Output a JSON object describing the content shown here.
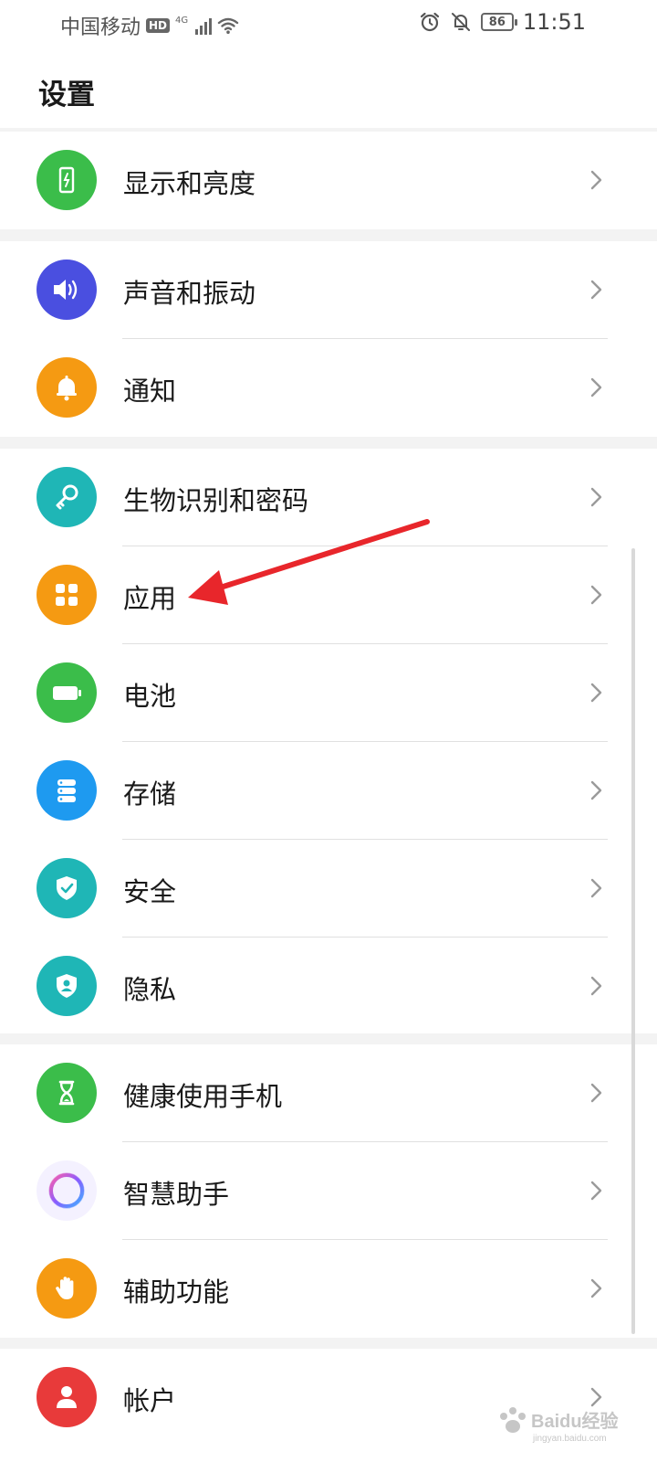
{
  "status_bar": {
    "carrier": "中国移动",
    "hd_badge": "HD",
    "network": "4G",
    "battery": "86",
    "time": "11:51"
  },
  "page": {
    "title": "设置"
  },
  "groups": [
    {
      "items": [
        {
          "label": "显示和亮度",
          "icon": "phone-display-icon",
          "color": "#3bbd4a"
        }
      ]
    },
    {
      "items": [
        {
          "label": "声音和振动",
          "icon": "speaker-icon",
          "color": "#4a4fe0"
        },
        {
          "label": "通知",
          "icon": "bell-icon",
          "color": "#f59a12"
        }
      ]
    },
    {
      "items": [
        {
          "label": "生物识别和密码",
          "icon": "key-icon",
          "color": "#1fb6b6"
        },
        {
          "label": "应用",
          "icon": "apps-grid-icon",
          "color": "#f59a12"
        },
        {
          "label": "电池",
          "icon": "battery-icon",
          "color": "#3bbd4a"
        },
        {
          "label": "存储",
          "icon": "storage-icon",
          "color": "#1e9af0"
        },
        {
          "label": "安全",
          "icon": "shield-check-icon",
          "color": "#1fb6b6"
        },
        {
          "label": "隐私",
          "icon": "privacy-shield-icon",
          "color": "#1fb6b6"
        }
      ]
    },
    {
      "items": [
        {
          "label": "健康使用手机",
          "icon": "hourglass-icon",
          "color": "#3bbd4a"
        },
        {
          "label": "智慧助手",
          "icon": "assistant-ring-icon",
          "color": "#f4f1ff"
        },
        {
          "label": "辅助功能",
          "icon": "hand-icon",
          "color": "#f59a12"
        }
      ]
    },
    {
      "items": [
        {
          "label": "帐户",
          "icon": "account-icon",
          "color": "#e83a3a"
        }
      ]
    }
  ],
  "annotation": {
    "arrow_color": "#e8262b"
  },
  "watermark": {
    "text": "Baidu经验",
    "sub": "jingyan.baidu.com"
  }
}
